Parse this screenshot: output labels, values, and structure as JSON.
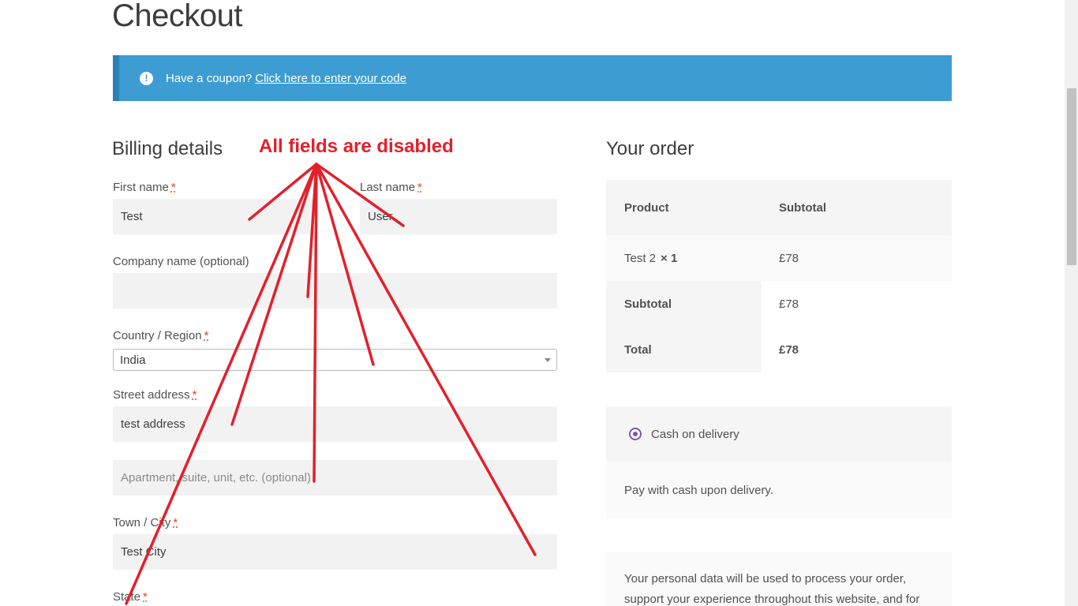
{
  "page": {
    "title": "Checkout"
  },
  "coupon": {
    "icon": "exclamation-circle-icon",
    "text": "Have a coupon?",
    "link": "Click here to enter your code"
  },
  "billing": {
    "heading": "Billing details",
    "required_marker": "*",
    "first_name": {
      "label": "First name",
      "value": "Test"
    },
    "last_name": {
      "label": "Last name",
      "value": "User"
    },
    "company": {
      "label": "Company name (optional)",
      "value": ""
    },
    "country": {
      "label": "Country / Region",
      "value": "India"
    },
    "street": {
      "label": "Street address",
      "value": "test address",
      "placeholder2": "Apartment, suite, unit, etc. (optional)"
    },
    "town": {
      "label": "Town / City",
      "value": "Test City"
    },
    "state": {
      "label": "State"
    }
  },
  "annotation": {
    "text": "All fields are disabled",
    "color": "#e3202b"
  },
  "order": {
    "heading": "Your order",
    "headers": {
      "product": "Product",
      "subtotal": "Subtotal"
    },
    "item": {
      "name": "Test 2",
      "qty": "× 1",
      "price": "£78"
    },
    "subtotal": {
      "label": "Subtotal",
      "value": "£78"
    },
    "total": {
      "label": "Total",
      "value": "£78"
    }
  },
  "payment": {
    "method": "Cash on delivery",
    "description": "Pay with cash upon delivery.",
    "accent_color": "#7f54b3"
  },
  "privacy": {
    "text": "Your personal data will be used to process your order, support your experience throughout this website, and for"
  },
  "colors": {
    "coupon_bg": "#3d9cd2",
    "required": "#e2401c",
    "field_bg": "#f2f2f2"
  }
}
